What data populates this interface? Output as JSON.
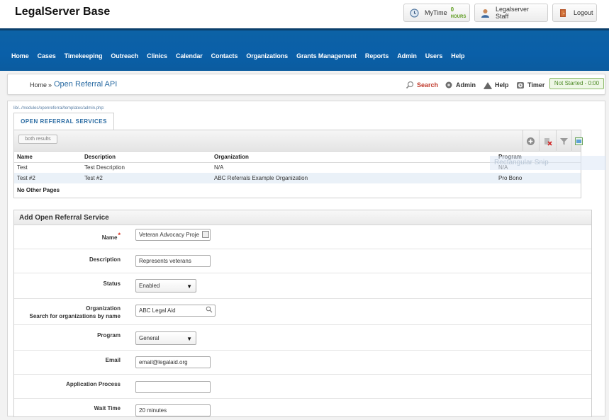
{
  "header": {
    "app_title": "LegalServer Base",
    "mytime_label": "MyTime",
    "mytime_hours": "0",
    "mytime_hours_unit": "HOURS",
    "user_label": "Legalserver Staff",
    "logout_label": "Logout"
  },
  "nav": {
    "items": [
      "Home",
      "Cases",
      "Timekeeping",
      "Outreach",
      "Clinics",
      "Calendar",
      "Contacts",
      "Organizations",
      "Grants Management",
      "Reports",
      "Admin",
      "Users",
      "Help"
    ]
  },
  "breadcrumb": {
    "home": "Home",
    "separator": "»",
    "page": "Open Referral API",
    "search": "Search",
    "admin": "Admin",
    "help": "Help",
    "timer": "Timer",
    "timer_status": "Not Started - 0:00"
  },
  "main": {
    "path_text": "lib/../modules/openreferral/templates/admin.php:",
    "tab_label": "OPEN REFERRAL SERVICES",
    "both_results_label": "both results",
    "columns": [
      "Name",
      "Description",
      "Organization",
      "Program"
    ],
    "rows": [
      [
        "Test",
        "Test Description",
        "N/A",
        "N/A"
      ],
      [
        "Test #2",
        "Test #2",
        "ABC Referrals Example Organization",
        "Pro Bono"
      ]
    ],
    "no_pages": "No Other Pages",
    "ghost_overlay": "Rectangular Snip"
  },
  "form": {
    "title": "Add Open Referral Service",
    "name_label": "Name",
    "name_required": "*",
    "name_value": "Veteran Advocacy Proje",
    "description_label": "Description",
    "description_value": "Represents veterans",
    "status_label": "Status",
    "status_value": "Enabled",
    "organization_label": "Organization",
    "organization_sub": "Search for organizations by name",
    "organization_value": "ABC Legal Aid",
    "program_label": "Program",
    "program_value": "General",
    "email_label": "Email",
    "email_value": "email@legalaid.org",
    "application_label": "Application Process",
    "application_value": "",
    "wait_label": "Wait Time",
    "wait_value": "20 minutes"
  },
  "colors": {
    "nav_blue": "#0a5fa8",
    "link_blue": "#2b6ca3",
    "status_green": "#4d8a26",
    "required_red": "#d62c1a"
  }
}
